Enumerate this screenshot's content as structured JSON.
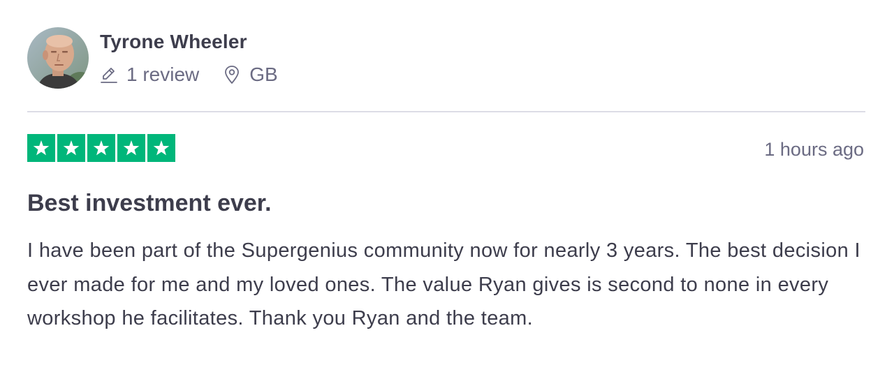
{
  "reviewer": {
    "name": "Tyrone Wheeler",
    "review_count": "1 review",
    "country": "GB",
    "avatar_icon": "person-photo-icon"
  },
  "review": {
    "rating": 5,
    "rating_max": 5,
    "star_color": "#00b67a",
    "timestamp": "1 hours ago",
    "title": "Best investment ever.",
    "body": "I have been part of the Supergenius community now for nearly 3 years. The best decision I ever made for me and my loved ones. The value Ryan gives is second to none in every workshop he facilitates. Thank you Ryan and the team."
  },
  "icons": {
    "review_count": "pencil-icon",
    "location": "location-pin-icon",
    "star": "star-icon"
  }
}
